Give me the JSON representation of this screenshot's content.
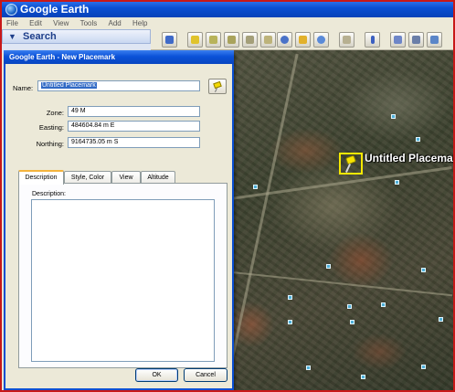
{
  "app": {
    "title": "Google Earth",
    "menu": [
      "File",
      "Edit",
      "View",
      "Tools",
      "Add",
      "Help"
    ]
  },
  "sidebar": {
    "search_label": "Search"
  },
  "map": {
    "placemark_label": "Untitled Placemark"
  },
  "dialog": {
    "title": "Google Earth - New Placemark",
    "name_label": "Name:",
    "name_value": "Untitled Placemark",
    "zone_label": "Zone:",
    "zone_value": "49 M",
    "easting_label": "Easting:",
    "easting_value": "484604.84 m E",
    "northing_label": "Northing:",
    "northing_value": "9164735.05 m S",
    "tabs": [
      {
        "label": "Description"
      },
      {
        "label": "Style, Color"
      },
      {
        "label": "View"
      },
      {
        "label": "Altitude"
      }
    ],
    "description_label": "Description:",
    "ok_label": "OK",
    "cancel_label": "Cancel"
  }
}
